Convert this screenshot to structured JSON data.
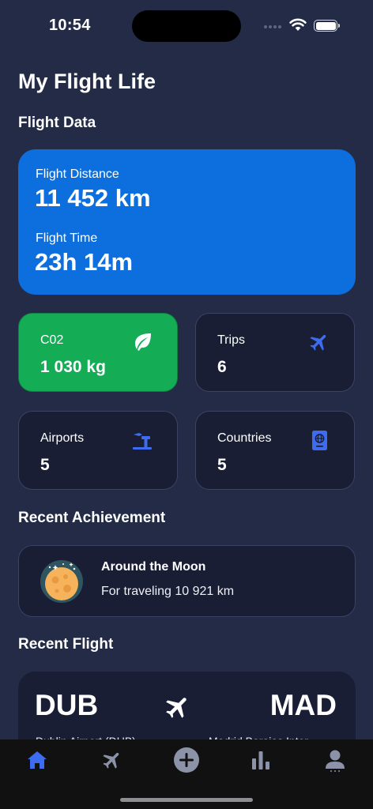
{
  "status_bar": {
    "time": "10:54"
  },
  "app": {
    "title": "My Flight Life"
  },
  "sections": {
    "flight_data": "Flight Data",
    "recent_achievement": "Recent Achievement",
    "recent_flight": "Recent Flight"
  },
  "hero": {
    "distance_label": "Flight Distance",
    "distance_value": "11 452 km",
    "time_label": "Flight Time",
    "time_value": "23h 14m",
    "color": "#0c6fdd"
  },
  "stats": {
    "co2": {
      "label": "C02",
      "value": "1 030 kg",
      "icon": "leaf-icon",
      "color": "#15ac56"
    },
    "trips": {
      "label": "Trips",
      "value": "6",
      "icon": "airplane-icon"
    },
    "airports": {
      "label": "Airports",
      "value": "5",
      "icon": "airport-tower-icon"
    },
    "countries": {
      "label": "Countries",
      "value": "5",
      "icon": "passport-icon"
    }
  },
  "achievement": {
    "title": "Around the Moon",
    "description": "For traveling 10 921 km",
    "icon": "moon-icon"
  },
  "recent_flight": {
    "from_code": "DUB",
    "to_code": "MAD",
    "from_name": "Dublin Airport (DUB)",
    "to_name": "Madrid Barajas Inter..."
  },
  "tab_bar": {
    "items": [
      "home-icon",
      "airplane-icon",
      "add-circle-icon",
      "bar-chart-icon",
      "profile-icon"
    ],
    "active": "home-icon",
    "active_color": "#3d6cf0"
  }
}
